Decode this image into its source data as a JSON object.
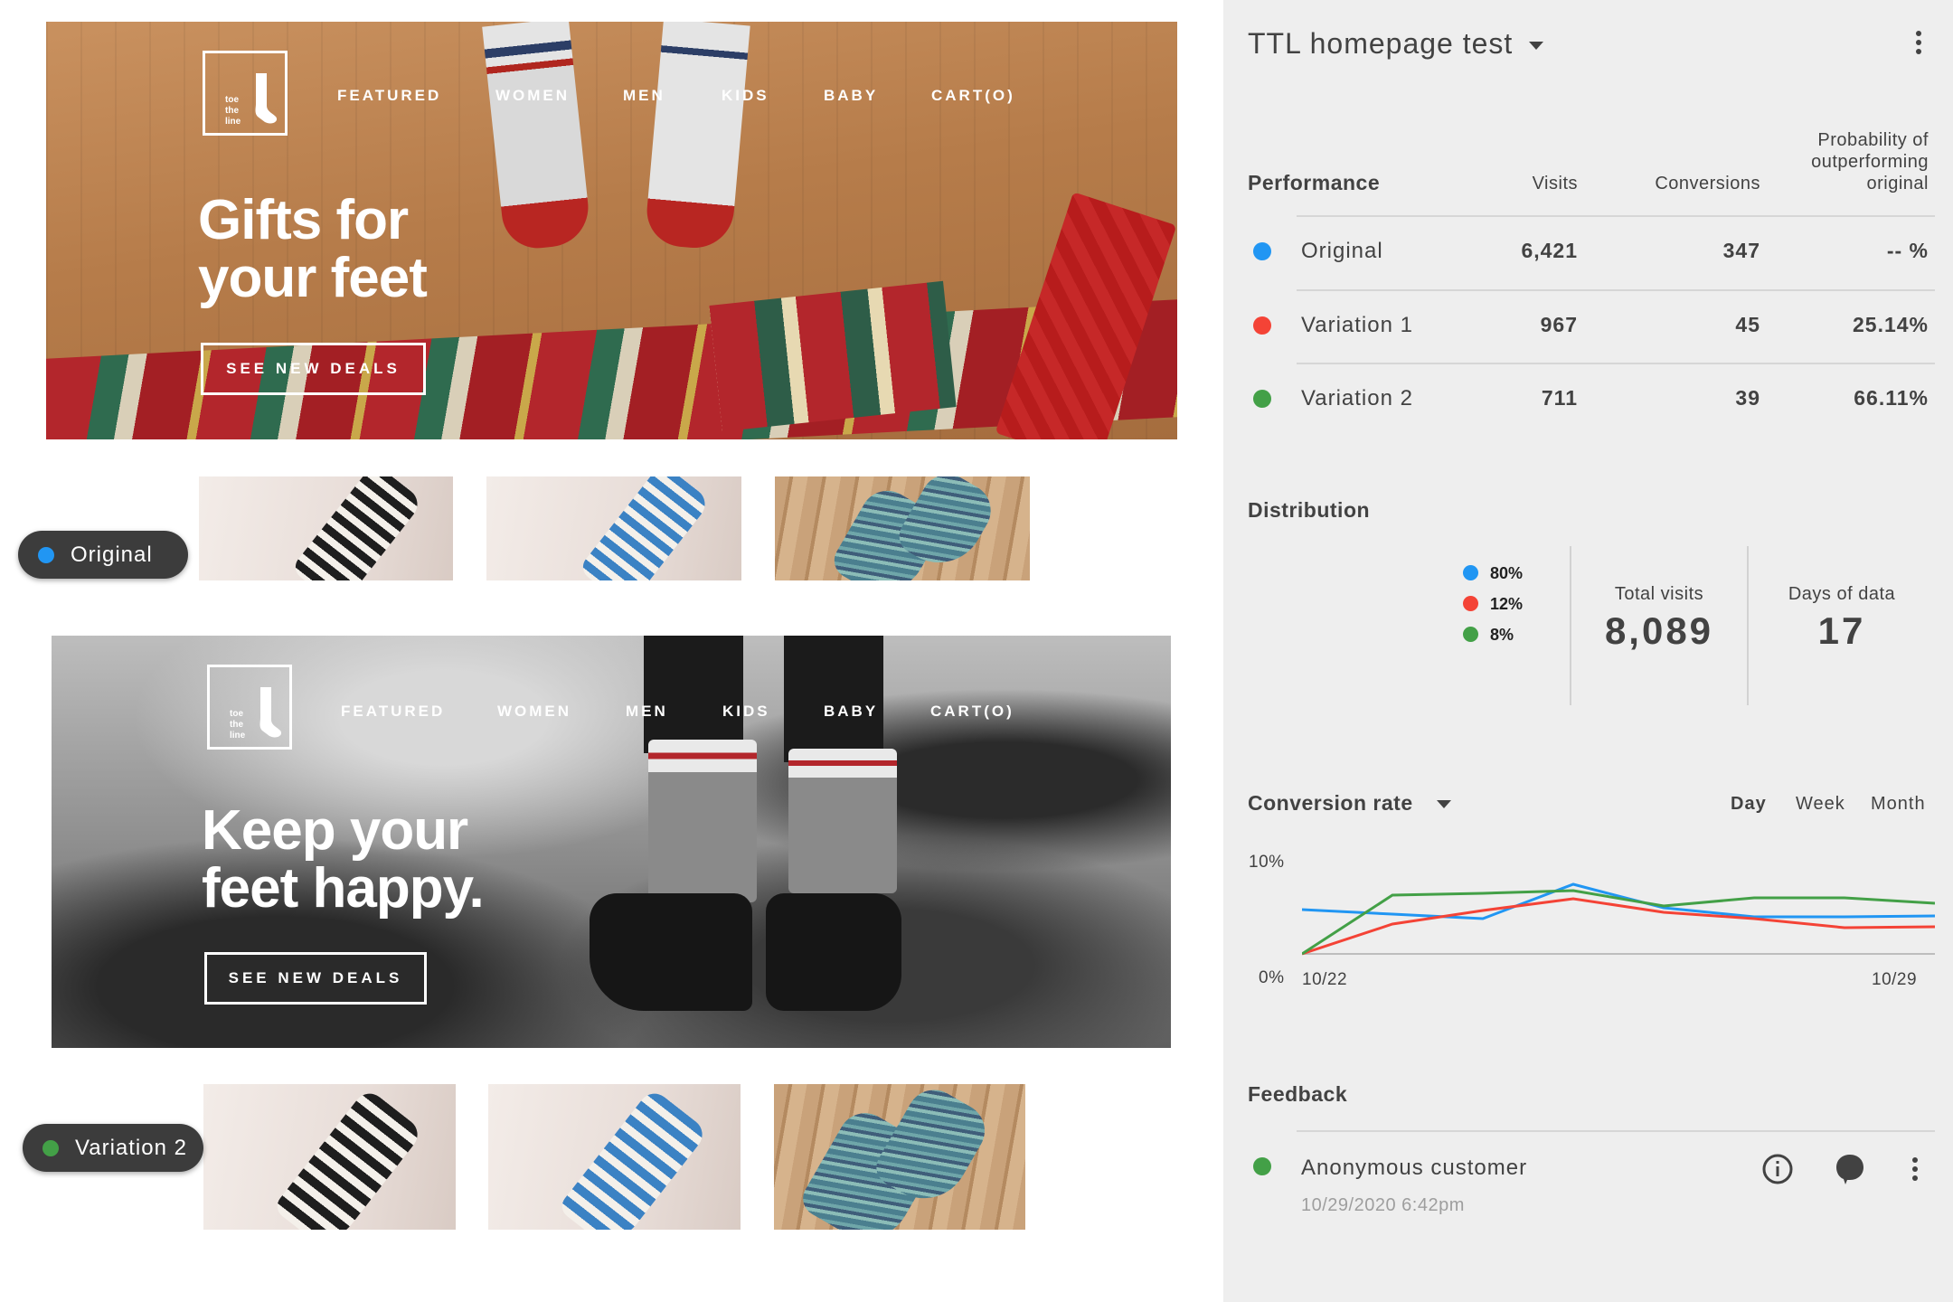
{
  "variant_original": {
    "logo_text": [
      "toe",
      "the",
      "line"
    ],
    "nav": [
      "FEATURED",
      "WOMEN",
      "MEN",
      "KIDS",
      "BABY",
      "CART(O)"
    ],
    "headline": [
      "Gifts for",
      "your feet"
    ],
    "cta": "SEE NEW DEALS",
    "label": "Original",
    "label_color": "#2196f3"
  },
  "variant_two": {
    "logo_text": [
      "toe",
      "the",
      "line"
    ],
    "nav": [
      "FEATURED",
      "WOMEN",
      "MEN",
      "KIDS",
      "BABY",
      "CART(O)"
    ],
    "headline": [
      "Keep your",
      "feet happy."
    ],
    "cta": "SEE NEW DEALS",
    "label": "Variation 2",
    "label_color": "#43a047"
  },
  "panel": {
    "title": "TTL homepage test",
    "performance": {
      "heading": "Performance",
      "col_visits": "Visits",
      "col_conversions": "Conversions",
      "col_probability": [
        "Probability of",
        "outperforming",
        "original"
      ],
      "rows": [
        {
          "name": "Original",
          "visits": "6,421",
          "conversions": "347",
          "probability": "-- %",
          "color": "#2196f3"
        },
        {
          "name": "Variation 1",
          "visits": "967",
          "conversions": "45",
          "probability": "25.14%",
          "color": "#f44336"
        },
        {
          "name": "Variation 2",
          "visits": "711",
          "conversions": "39",
          "probability": "66.11%",
          "color": "#43a047"
        }
      ]
    },
    "distribution": {
      "heading": "Distribution",
      "legend": [
        {
          "label": "80%",
          "color": "#2196f3"
        },
        {
          "label": "12%",
          "color": "#f44336"
        },
        {
          "label": "8%",
          "color": "#43a047"
        }
      ],
      "total_visits_label": "Total visits",
      "total_visits": "8,089",
      "days_label": "Days of data",
      "days": "17"
    },
    "conversion": {
      "heading": "Conversion rate",
      "ranges": [
        "Day",
        "Week",
        "Month"
      ],
      "active_range": "Day"
    },
    "feedback": {
      "heading": "Feedback",
      "name": "Anonymous customer",
      "time": "10/29/2020 6:42pm",
      "dot_color": "#43a047"
    }
  },
  "chart_data": {
    "type": "line",
    "x": [
      "10/22",
      "10/23",
      "10/24",
      "10/25",
      "10/26",
      "10/27",
      "10/28",
      "10/29"
    ],
    "x_tick_labels": [
      "10/22",
      "10/29"
    ],
    "y_tick_labels": [
      "10%",
      "0%"
    ],
    "ylim": [
      0,
      10
    ],
    "series": [
      {
        "color": "#2196f3",
        "values": [
          4.9,
          4.4,
          3.9,
          7.7,
          5.1,
          4.1,
          4.1,
          4.2
        ]
      },
      {
        "color": "#f44336",
        "values": [
          0.0,
          3.3,
          4.8,
          6.1,
          4.6,
          3.9,
          2.9,
          3.0
        ]
      },
      {
        "color": "#43a047",
        "values": [
          0.0,
          6.5,
          6.7,
          7.0,
          5.3,
          6.2,
          6.2,
          5.6
        ]
      }
    ]
  }
}
